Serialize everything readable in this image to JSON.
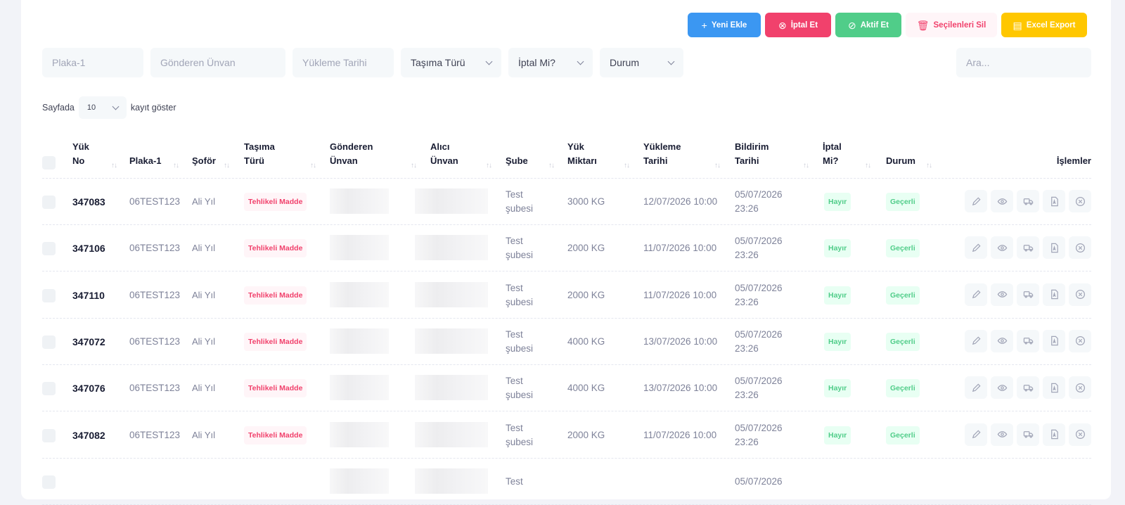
{
  "toolbar": {
    "new_label": "Yeni Ekle",
    "cancel_label": "İptal Et",
    "activate_label": "Aktif Et",
    "delete_selected_label": "Seçilenleri Sil",
    "excel_label": "Excel Export"
  },
  "filters": {
    "plaka_placeholder": "Plaka-1",
    "gonderen_placeholder": "Gönderen Ünvan",
    "yukleme_placeholder": "Yükleme Tarihi",
    "tasima_turu": "Taşıma Türü",
    "iptal_mi": "İptal Mi?",
    "durum": "Durum",
    "search_placeholder": "Ara..."
  },
  "pagination": {
    "prefix": "Sayfada",
    "per_page": "10",
    "suffix": "kayıt göster"
  },
  "columns": {
    "yuk_no": "Yük No",
    "plaka": "Plaka-1",
    "sofor": "Şoför",
    "tasima_turu": "Taşıma Türü",
    "gonderen": "Gönderen Ünvan",
    "alici": "Alıcı Ünvan",
    "sube": "Şube",
    "yuk_miktari": "Yük Miktarı",
    "yukleme_tarihi": "Yükleme Tarihi",
    "bildirim_tarihi": "Bildirim Tarihi",
    "iptal_mi": "İptal Mi?",
    "durum": "Durum",
    "islemler": "İşlemler"
  },
  "rows": [
    {
      "yuk_no": "347083",
      "plaka": "06TEST123",
      "sofor": "Ali Yıl",
      "tasima": "Tehlikeli Madde",
      "sube": "Test şubesi",
      "miktar": "3000 KG",
      "yukleme": "12/07/2026 10:00",
      "bildirim": "05/07/2026 23:26",
      "iptal": "Hayır",
      "durum": "Geçerli"
    },
    {
      "yuk_no": "347106",
      "plaka": "06TEST123",
      "sofor": "Ali Yıl",
      "tasima": "Tehlikeli Madde",
      "sube": "Test şubesi",
      "miktar": "2000 KG",
      "yukleme": "11/07/2026 10:00",
      "bildirim": "05/07/2026 23:26",
      "iptal": "Hayır",
      "durum": "Geçerli"
    },
    {
      "yuk_no": "347110",
      "plaka": "06TEST123",
      "sofor": "Ali Yıl",
      "tasima": "Tehlikeli Madde",
      "sube": "Test şubesi",
      "miktar": "2000 KG",
      "yukleme": "11/07/2026 10:00",
      "bildirim": "05/07/2026 23:26",
      "iptal": "Hayır",
      "durum": "Geçerli"
    },
    {
      "yuk_no": "347072",
      "plaka": "06TEST123",
      "sofor": "Ali Yıl",
      "tasima": "Tehlikeli Madde",
      "sube": "Test şubesi",
      "miktar": "4000 KG",
      "yukleme": "13/07/2026 10:00",
      "bildirim": "05/07/2026 23:26",
      "iptal": "Hayır",
      "durum": "Geçerli"
    },
    {
      "yuk_no": "347076",
      "plaka": "06TEST123",
      "sofor": "Ali Yıl",
      "tasima": "Tehlikeli Madde",
      "sube": "Test şubesi",
      "miktar": "4000 KG",
      "yukleme": "13/07/2026 10:00",
      "bildirim": "05/07/2026 23:26",
      "iptal": "Hayır",
      "durum": "Geçerli"
    },
    {
      "yuk_no": "347082",
      "plaka": "06TEST123",
      "sofor": "Ali Yıl",
      "tasima": "Tehlikeli Madde",
      "sube": "Test şubesi",
      "miktar": "2000 KG",
      "yukleme": "11/07/2026 10:00",
      "bildirim": "05/07/2026 23:26",
      "iptal": "Hayır",
      "durum": "Geçerli"
    },
    {
      "yuk_no": "",
      "plaka": "",
      "sofor": "",
      "tasima": "",
      "sube": "Test",
      "miktar": "",
      "yukleme": "",
      "bildirim": "05/07/2026",
      "iptal": "",
      "durum": ""
    }
  ],
  "icons": [
    "plus-icon",
    "x-circle-icon",
    "check-circle-icon",
    "trash-icon",
    "file-icon",
    "pencil-icon",
    "eye-icon",
    "truck-icon",
    "pdf-icon",
    "sort-icon",
    "chevron-down-icon"
  ],
  "colors": {
    "primary": "#3b97f2",
    "danger": "#f1416c",
    "success": "#50cd89",
    "warning": "#ffc700"
  }
}
